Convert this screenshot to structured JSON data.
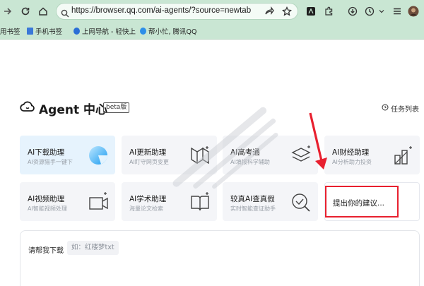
{
  "browser": {
    "url": "https://browser.qq.com/ai-agents/?source=newtab",
    "bookmarks": [
      "用书签",
      "手机书签",
      "上网导航 - 轻快上",
      "帮小忙, 腾讯QQ"
    ]
  },
  "header": {
    "title": "Agent 中心",
    "badge": "beta版",
    "task_list": "任务列表"
  },
  "cards": [
    {
      "title": "AI下载助理",
      "desc": "AI资源猫手一键下"
    },
    {
      "title": "AI更新助理",
      "desc": "AI盯守网页变更"
    },
    {
      "title": "AI高考通",
      "desc": "AI填报科学辅助"
    },
    {
      "title": "AI财经助理",
      "desc": "AI分析助力投资"
    },
    {
      "title": "AI视频助理",
      "desc": "AI智能视频处理"
    },
    {
      "title": "AI学术助理",
      "desc": "海量论文检索"
    },
    {
      "title": "较真AI查真假",
      "desc": "实时智能查证助手"
    },
    {
      "title": "提出你的建议..."
    }
  ],
  "input": {
    "label": "请帮我下载",
    "chip": "如：红楼梦txt"
  },
  "colors": {
    "chrome": "#c9e6d3",
    "active_card": "#e6f3fd",
    "annotation_red": "#e8202f"
  }
}
